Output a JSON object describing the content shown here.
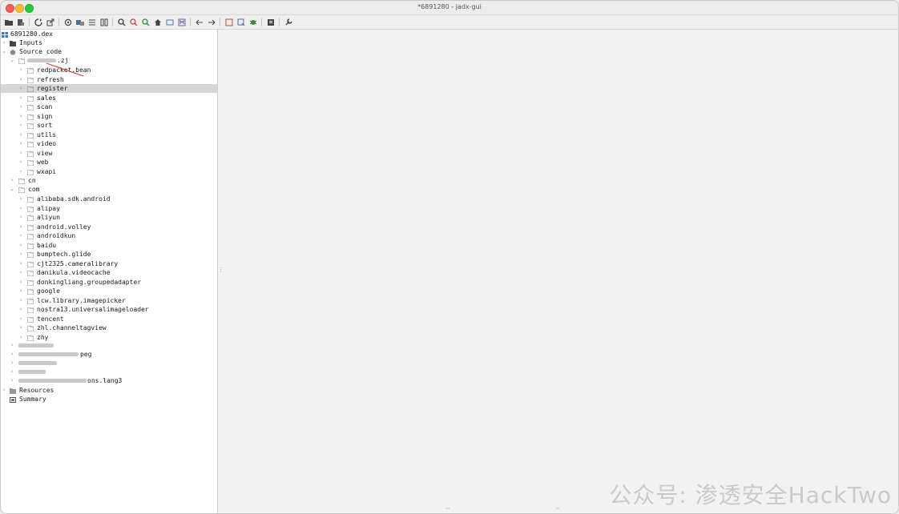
{
  "window": {
    "title": "*6891280 - jadx-gui"
  },
  "toolbar": {
    "icons": [
      "open-file-icon",
      "add-files-icon",
      "reload-icon",
      "export-icon",
      "preferences-icon",
      "decompile-all-icon",
      "sync-icon",
      "flatten-icon",
      "search-icon",
      "find-class-icon",
      "find-usage-icon",
      "home-icon",
      "log-icon",
      "smali-icon",
      "back-icon",
      "forward-icon",
      "deobfuscation-icon",
      "quark-icon",
      "debug-icon",
      "log-viewer-icon",
      "settings-icon"
    ]
  },
  "tree": {
    "root": "6891280.dex",
    "inputs": "Inputs",
    "source_code": "Source code",
    "package_suffix": ".zj",
    "subpackages": [
      "redpacket.bean",
      "refresh",
      "register",
      "sales",
      "scan",
      "sign",
      "sort",
      "utils",
      "video",
      "view",
      "web",
      "wxapi"
    ],
    "cn": "cn",
    "com": "com",
    "com_children": [
      "alibaba.sdk.android",
      "alipay",
      "aliyun",
      "android.volley",
      "androidkun",
      "baidu",
      "bumptech.glide",
      "cjt2325.cameralibrary",
      "danikula.videocache",
      "donkingliang.groupedadapter",
      "google",
      "lcw.library.imagepicker",
      "nostra13.universalimageloader",
      "tencent",
      "zhl.channeltagview",
      "zhy"
    ],
    "obscured_suffix_1": "peg",
    "obscured_suffix_2": "ons.lang3",
    "resources": "Resources",
    "summary": "Summary"
  },
  "watermark": "公众号: 渗透安全HackTwo",
  "colors": {
    "selection": "#d6d6d6",
    "folder": "#8a8a8a",
    "accent_arrow": "#d9362b"
  }
}
